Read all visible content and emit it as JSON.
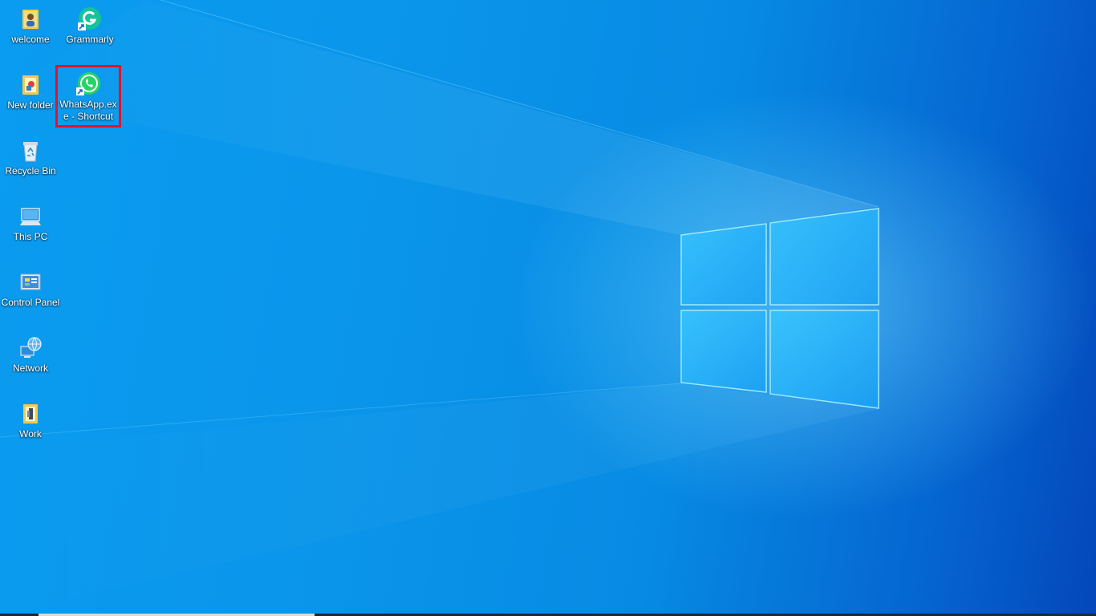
{
  "desktop": {
    "icons": [
      {
        "name": "welcome-icon",
        "label": "welcome",
        "icon": "user-folder-icon"
      },
      {
        "name": "grammarly-icon",
        "label": "Grammarly",
        "icon": "grammarly-shortcut-icon"
      },
      {
        "name": "new-folder-icon",
        "label": "New folder",
        "icon": "folder-icon"
      },
      {
        "name": "whatsapp-shortcut-icon",
        "label": "WhatsApp.exe - Shortcut",
        "icon": "whatsapp-shortcut-icon",
        "selected": true
      },
      {
        "name": "recycle-bin-icon",
        "label": "Recycle Bin",
        "icon": "recycle-bin-icon"
      },
      {
        "name": "this-pc-icon",
        "label": "This PC",
        "icon": "computer-icon"
      },
      {
        "name": "control-panel-icon",
        "label": "Control Panel",
        "icon": "control-panel-icon"
      },
      {
        "name": "network-icon",
        "label": "Network",
        "icon": "network-globe-icon"
      },
      {
        "name": "work-icon",
        "label": "Work",
        "icon": "folder-icon"
      }
    ],
    "highlight_color": "#e81123",
    "wallpaper_colors": [
      "#0a9cf0",
      "#0566d1",
      "#0447bb"
    ]
  }
}
